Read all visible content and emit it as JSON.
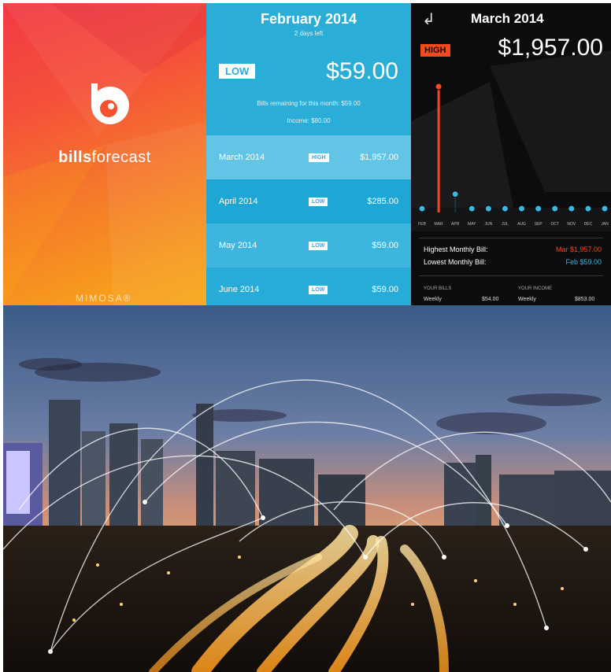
{
  "splash": {
    "app_name_bold": "bills",
    "app_name_light": "forecast",
    "brand": "MIMOSA®"
  },
  "current": {
    "month": "February 2014",
    "subtitle": "2 days left",
    "level": "LOW",
    "amount": "$59.00",
    "remaining_note": "Bills remaining for this month: $59.00",
    "income_note": "Income: $80.00"
  },
  "upcoming": [
    {
      "month": "March 2014",
      "level": "HIGH",
      "amount": "$1,957.00"
    },
    {
      "month": "April 2014",
      "level": "LOW",
      "amount": "$285.00"
    },
    {
      "month": "May 2014",
      "level": "LOW",
      "amount": "$59.00"
    },
    {
      "month": "June 2014",
      "level": "LOW",
      "amount": "$59.00"
    }
  ],
  "detail": {
    "back_icon": "back-arrow-icon",
    "month": "March 2014",
    "level": "HIGH",
    "amount": "$1,957.00",
    "highest_label": "Highest Monthly Bill:",
    "highest_value": "Mar $1,957.00",
    "lowest_label": "Lowest Monthly Bill:",
    "lowest_value": "Feb $59.00",
    "your_bills_label": "YOUR BILLS",
    "your_bills_period": "Weekly",
    "your_bills_value": "$54.00",
    "your_income_label": "YOUR INCOME",
    "your_income_period": "Weekly",
    "your_income_value": "$853.00"
  },
  "chart_data": {
    "type": "line",
    "categories": [
      "FEB",
      "MAR",
      "APR",
      "MAY",
      "JUN",
      "JUL",
      "AUG",
      "SEP",
      "OCT",
      "NOV",
      "DEC",
      "JAN"
    ],
    "values": [
      59,
      1957,
      285,
      59,
      59,
      59,
      59,
      59,
      59,
      59,
      59,
      59
    ],
    "highlight_index": 1
  },
  "colors": {
    "blue": "#2aaed8",
    "high": "#f24a1d",
    "low": "#3ab8e0",
    "dark_bg": "#0c0c0e"
  }
}
